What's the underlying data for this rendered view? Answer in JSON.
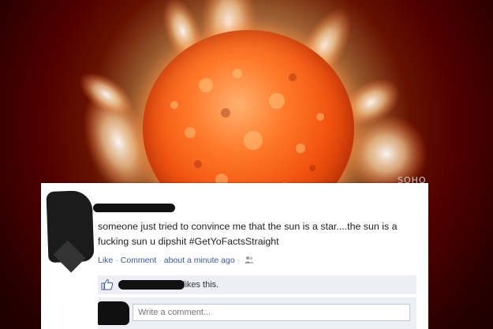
{
  "watermark": "SOHO",
  "post": {
    "text": "someone just tried to convince me that the sun is a star....the sun is a fucking sun u dipshit #GetYoFactsStraight",
    "actions": {
      "like": "Like",
      "separator": "·",
      "comment": "Comment",
      "timestamp": "about a minute ago"
    },
    "likes_suffix": "likes this.",
    "comment_placeholder": "Write a comment..."
  },
  "colors": {
    "link": "#3b5998",
    "likes_background": "#edeff4",
    "input_border": "#bdc7d8"
  },
  "icons": {
    "like": "thumbs-up-icon",
    "audience": "friends-icon"
  }
}
